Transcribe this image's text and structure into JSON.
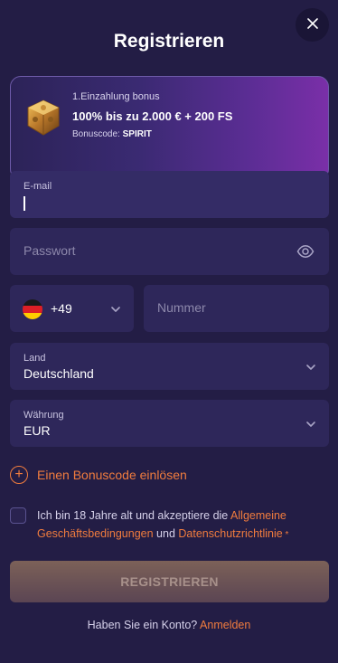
{
  "modal": {
    "title": "Registrieren"
  },
  "banner": {
    "line1": "1.Einzahlung bonus",
    "line2": "100% bis zu 2.000 € + 200 FS",
    "code_label": "Bonuscode:",
    "code_value": "SPIRIT"
  },
  "form": {
    "email": {
      "label": "E-mail",
      "value": ""
    },
    "password": {
      "placeholder": "Passwort"
    },
    "phone": {
      "code": "+49",
      "placeholder": "Nummer"
    },
    "country": {
      "label": "Land",
      "value": "Deutschland"
    },
    "currency": {
      "label": "Währung",
      "value": "EUR"
    }
  },
  "promo": {
    "label": "Einen Bonuscode einlösen"
  },
  "terms": {
    "text_before": "Ich bin 18 Jahre alt und akzeptiere die ",
    "link_terms": "Allgemeine Geschäftsbedingungen",
    "text_middle": " und ",
    "link_privacy": "Datenschutzrichtlinie",
    "required_mark": " *"
  },
  "register_button": {
    "label": "REGISTRIEREN"
  },
  "login": {
    "prompt": "Haben Sie ein Konto? ",
    "link": "Anmelden"
  },
  "colors": {
    "background": "#231d45",
    "field": "#2e275a",
    "accent": "#f07c3e"
  },
  "icons": [
    "close-icon",
    "bonus-chest-icon",
    "eye-icon",
    "germany-flag-icon",
    "chevron-down-icon",
    "plus-circle-icon"
  ]
}
